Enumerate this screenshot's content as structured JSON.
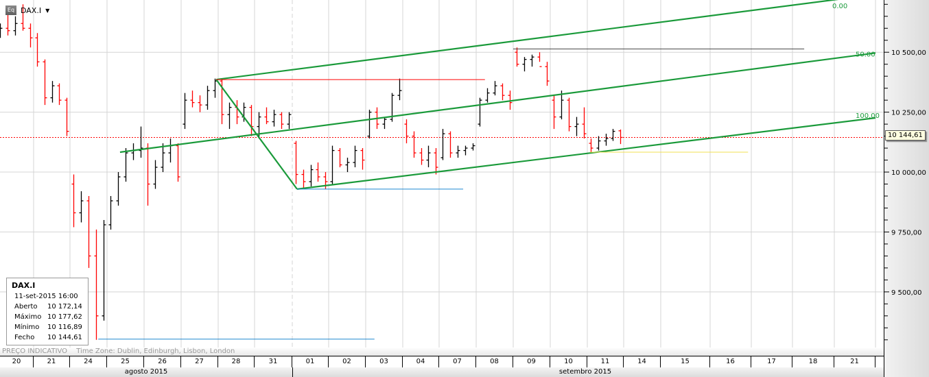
{
  "header": {
    "symbol": "DAX.I",
    "icon": "equity-icon",
    "dropdown_icon": "caret-down-icon",
    "icon_text": "Eq"
  },
  "info_box": {
    "title": "DAX.I",
    "datetime": "11-set-2015 16:00",
    "rows": [
      {
        "label": "Aberto",
        "value": "10 172,14"
      },
      {
        "label": "Máximo",
        "value": "10 177,62"
      },
      {
        "label": "Mínimo",
        "value": "10 116,89"
      },
      {
        "label": "Fecho",
        "value": "10 144,61"
      }
    ]
  },
  "footer": {
    "price_note": "PREÇO INDICATIVO",
    "timezone": "Time Zone: Dublin, Edinburgh, Lisbon, London"
  },
  "months": [
    "agosto 2015",
    "setembro 2015"
  ],
  "current_price_label": "10 144,61",
  "chart_data": {
    "type": "ohlc",
    "symbol": "DAX.I",
    "ylim": [
      9265,
      10718
    ],
    "yticks": [
      9500,
      9750,
      10000,
      10250,
      10500
    ],
    "ytick_labels": [
      "9 500,00",
      "9 750,00",
      "10 000,00",
      "10 250,00",
      "10 500,00"
    ],
    "grid": true,
    "colors": {
      "up": "#000000",
      "down": "#ff0000",
      "pitchfork": "#1a9a3a",
      "current_price": "#ff0000"
    },
    "days": [
      "20",
      "21",
      "24",
      "25",
      "26",
      "27",
      "28",
      "31",
      "01",
      "02",
      "03",
      "04",
      "07",
      "08",
      "09",
      "10",
      "11",
      "14",
      "15",
      "16",
      "17",
      "18",
      "21"
    ],
    "current_price": 10144.61,
    "bars_per_day": {
      "20": [
        [
          10580,
          10620,
          10560,
          10600
        ],
        [
          10600,
          10660,
          10570,
          10590
        ],
        [
          10590,
          10650,
          10570,
          10620
        ],
        [
          10620,
          10700,
          10590,
          10600
        ],
        [
          10600,
          10620,
          10520,
          10560
        ]
      ],
      "21": [
        [
          10560,
          10580,
          10440,
          10460
        ],
        [
          10460,
          10470,
          10280,
          10310
        ],
        [
          10310,
          10380,
          10290,
          10360
        ],
        [
          10360,
          10370,
          10280,
          10300
        ],
        [
          10300,
          10310,
          10150,
          10170
        ]
      ],
      "24": [
        [
          9950,
          9990,
          9770,
          9830
        ],
        [
          9830,
          9920,
          9790,
          9880
        ],
        [
          9880,
          9900,
          9600,
          9650
        ],
        [
          9650,
          9760,
          9300,
          9400
        ],
        [
          9400,
          9800,
          9380,
          9780
        ]
      ],
      "25": [
        [
          9780,
          9900,
          9760,
          9880
        ],
        [
          9880,
          10000,
          9860,
          9980
        ],
        [
          9980,
          10100,
          9960,
          10080
        ],
        [
          10080,
          10120,
          10050,
          10090
        ],
        [
          10090,
          10190,
          10060,
          10100
        ]
      ],
      "26": [
        [
          10100,
          10120,
          9860,
          9950
        ],
        [
          9950,
          10050,
          9930,
          10020
        ],
        [
          10020,
          10120,
          10000,
          10080
        ],
        [
          10080,
          10140,
          10040,
          10110
        ],
        [
          10110,
          10120,
          9960,
          9980
        ]
      ],
      "27": [
        [
          10200,
          10330,
          10180,
          10300
        ],
        [
          10300,
          10340,
          10270,
          10290
        ],
        [
          10290,
          10320,
          10250,
          10280
        ],
        [
          10280,
          10360,
          10260,
          10340
        ],
        [
          10340,
          10390,
          10310,
          10380
        ]
      ],
      "28": [
        [
          10380,
          10390,
          10200,
          10240
        ],
        [
          10240,
          10290,
          10180,
          10270
        ],
        [
          10270,
          10300,
          10200,
          10230
        ],
        [
          10230,
          10290,
          10210,
          10270
        ],
        [
          10270,
          10280,
          10150,
          10190
        ]
      ],
      "31": [
        [
          10190,
          10250,
          10140,
          10230
        ],
        [
          10230,
          10270,
          10200,
          10210
        ],
        [
          10210,
          10260,
          10190,
          10240
        ],
        [
          10240,
          10250,
          10180,
          10200
        ],
        [
          10200,
          10250,
          10180,
          10240
        ]
      ],
      "01": [
        [
          10120,
          10130,
          9950,
          9990
        ],
        [
          9990,
          10010,
          9930,
          9960
        ],
        [
          9960,
          10030,
          9940,
          10010
        ],
        [
          10010,
          10040,
          9960,
          9980
        ],
        [
          9980,
          10000,
          9930,
          9960
        ]
      ],
      "02": [
        [
          9960,
          10110,
          9950,
          10090
        ],
        [
          10090,
          10100,
          10020,
          10030
        ],
        [
          10030,
          10060,
          10000,
          10040
        ],
        [
          10040,
          10110,
          10020,
          10090
        ],
        [
          10090,
          10100,
          10010,
          10050
        ]
      ],
      "03": [
        [
          10150,
          10260,
          10140,
          10250
        ],
        [
          10250,
          10270,
          10180,
          10200
        ],
        [
          10200,
          10230,
          10180,
          10220
        ],
        [
          10220,
          10330,
          10210,
          10320
        ],
        [
          10320,
          10390,
          10300,
          10340
        ]
      ],
      "04": [
        [
          10200,
          10220,
          10120,
          10150
        ],
        [
          10150,
          10170,
          10060,
          10080
        ],
        [
          10080,
          10100,
          10030,
          10050
        ],
        [
          10050,
          10110,
          10020,
          10080
        ],
        [
          10080,
          10100,
          9990,
          10020
        ]
      ],
      "07": [
        [
          10060,
          10180,
          10050,
          10160
        ],
        [
          10160,
          10170,
          10060,
          10080
        ],
        [
          10080,
          10110,
          10060,
          10090
        ],
        [
          10090,
          10110,
          10070,
          10100
        ],
        [
          10100,
          10120,
          10090,
          10110
        ]
      ],
      "08": [
        [
          10200,
          10310,
          10190,
          10300
        ],
        [
          10300,
          10350,
          10290,
          10330
        ],
        [
          10330,
          10380,
          10320,
          10360
        ],
        [
          10360,
          10370,
          10300,
          10320
        ],
        [
          10320,
          10340,
          10260,
          10290
        ]
      ],
      "09": [
        [
          10500,
          10520,
          10440,
          10450
        ],
        [
          10450,
          10480,
          10420,
          10470
        ],
        [
          10470,
          10490,
          10440,
          10480
        ],
        [
          10480,
          10500,
          10460,
          10440
        ],
        [
          10440,
          10460,
          10360,
          10380
        ]
      ],
      "10": [
        [
          10300,
          10320,
          10180,
          10230
        ],
        [
          10230,
          10340,
          10220,
          10300
        ],
        [
          10300,
          10310,
          10170,
          10190
        ],
        [
          10190,
          10230,
          10150,
          10200
        ],
        [
          10200,
          10270,
          10140,
          10160
        ]
      ],
      "11": [
        [
          10120,
          10140,
          10080,
          10100
        ],
        [
          10100,
          10150,
          10090,
          10130
        ],
        [
          10130,
          10160,
          10110,
          10140
        ],
        [
          10140,
          10180,
          10130,
          10170
        ],
        [
          10172.14,
          10177.62,
          10116.89,
          10144.61
        ]
      ]
    },
    "drawings": [
      {
        "kind": "pitchfork-handle",
        "color": "#1a9a3a",
        "from": {
          "day": 5,
          "time": "17:00",
          "price": 10386
        },
        "to": {
          "day": 8,
          "time": "09:15",
          "price": 9929
        }
      },
      {
        "kind": "pitchfork-line",
        "label": "0.00",
        "color": "#1a9a3a",
        "from": {
          "day": 5,
          "time": "17:00",
          "price": 10386
        },
        "to": {
          "day": 22,
          "time": "17:30",
          "price": 10741
        }
      },
      {
        "kind": "pitchfork-line",
        "label": "50.00",
        "color": "#1a9a3a",
        "from": {
          "day": 3,
          "time": "11:20",
          "price": 10083
        },
        "to": {
          "day": 22,
          "time": "17:30",
          "price": 10497
        }
      },
      {
        "kind": "pitchfork-line",
        "label": "100.00",
        "color": "#1a9a3a",
        "from": {
          "day": 8,
          "time": "09:15",
          "price": 9929
        },
        "to": {
          "day": 22,
          "time": "17:30",
          "price": 10226
        }
      },
      {
        "kind": "hline",
        "color": "#ff0000",
        "from": {
          "day": 5,
          "time": "17:00",
          "price": 10386
        },
        "to": {
          "day": 13,
          "time": "10:15",
          "price": 10386
        }
      },
      {
        "kind": "hline",
        "color": "#1e88d0",
        "from": {
          "day": 8,
          "time": "09:15",
          "price": 9929
        },
        "to": {
          "day": 12,
          "time": "14:10",
          "price": 9929
        }
      },
      {
        "kind": "hline",
        "color": "#1e88d0",
        "from": {
          "day": 2,
          "time": "15:15",
          "price": 9303
        },
        "to": {
          "day": 10,
          "time": "10:15",
          "price": 9303
        }
      },
      {
        "kind": "hline",
        "color": "#444444",
        "from": {
          "day": 14,
          "time": "08:00",
          "price": 10514
        },
        "to": {
          "day": 21,
          "time": "10:40",
          "price": 10514
        }
      },
      {
        "kind": "hline",
        "color": "#f0e050",
        "from": {
          "day": 16,
          "time": "08:40",
          "price": 10083
        },
        "to": {
          "day": 19,
          "time": "16:45",
          "price": 10083
        }
      }
    ]
  }
}
